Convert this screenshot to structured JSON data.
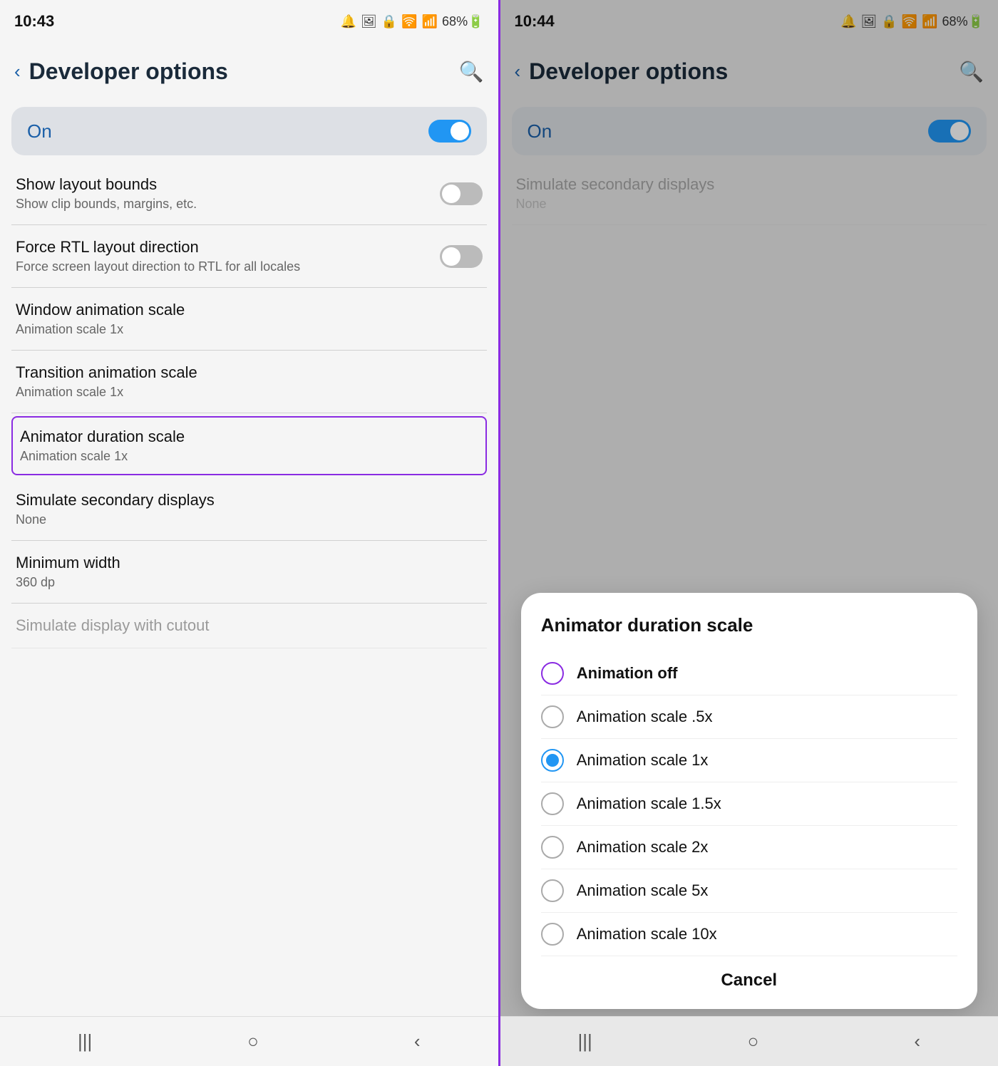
{
  "left_phone": {
    "status_time": "10:43",
    "status_icons": "🔔 🖼 🔒 📶 📶 68%🔋",
    "header": {
      "back_label": "‹",
      "title": "Developer options",
      "search_icon": "🔍"
    },
    "on_row": {
      "label": "On"
    },
    "settings": [
      {
        "title": "Show layout bounds",
        "subtitle": "Show clip bounds, margins, etc.",
        "has_toggle": true,
        "toggle_on": false
      },
      {
        "title": "Force RTL layout direction",
        "subtitle": "Force screen layout direction to RTL for all locales",
        "has_toggle": true,
        "toggle_on": false
      },
      {
        "title": "Window animation scale",
        "subtitle": "Animation scale 1x",
        "has_toggle": false
      },
      {
        "title": "Transition animation scale",
        "subtitle": "Animation scale 1x",
        "has_toggle": false
      },
      {
        "title": "Animator duration scale",
        "subtitle": "Animation scale 1x",
        "highlighted": true,
        "has_toggle": false
      },
      {
        "title": "Simulate secondary displays",
        "subtitle": "None",
        "has_toggle": false
      },
      {
        "title": "Minimum width",
        "subtitle": "360 dp",
        "has_toggle": false
      }
    ],
    "nav": [
      "|||",
      "○",
      "‹"
    ]
  },
  "right_phone": {
    "status_time": "10:44",
    "status_icons": "🔔 🖼 🔒 📶 📶 68%🔋",
    "header": {
      "back_label": "‹",
      "title": "Developer options",
      "search_icon": "🔍"
    },
    "on_row": {
      "label": "On"
    },
    "settings_bg": [
      {
        "title": "Simulate secondary displays",
        "subtitle": "None"
      }
    ],
    "dialog": {
      "title": "Animator duration scale",
      "options": [
        {
          "label": "Animation off",
          "selected": false,
          "highlighted": true
        },
        {
          "label": "Animation scale .5x",
          "selected": false,
          "highlighted": false
        },
        {
          "label": "Animation scale 1x",
          "selected": true,
          "highlighted": false
        },
        {
          "label": "Animation scale 1.5x",
          "selected": false,
          "highlighted": false
        },
        {
          "label": "Animation scale 2x",
          "selected": false,
          "highlighted": false
        },
        {
          "label": "Animation scale 5x",
          "selected": false,
          "highlighted": false
        },
        {
          "label": "Animation scale 10x",
          "selected": false,
          "highlighted": false
        }
      ],
      "cancel_label": "Cancel"
    },
    "nav": [
      "|||",
      "○",
      "‹"
    ]
  }
}
